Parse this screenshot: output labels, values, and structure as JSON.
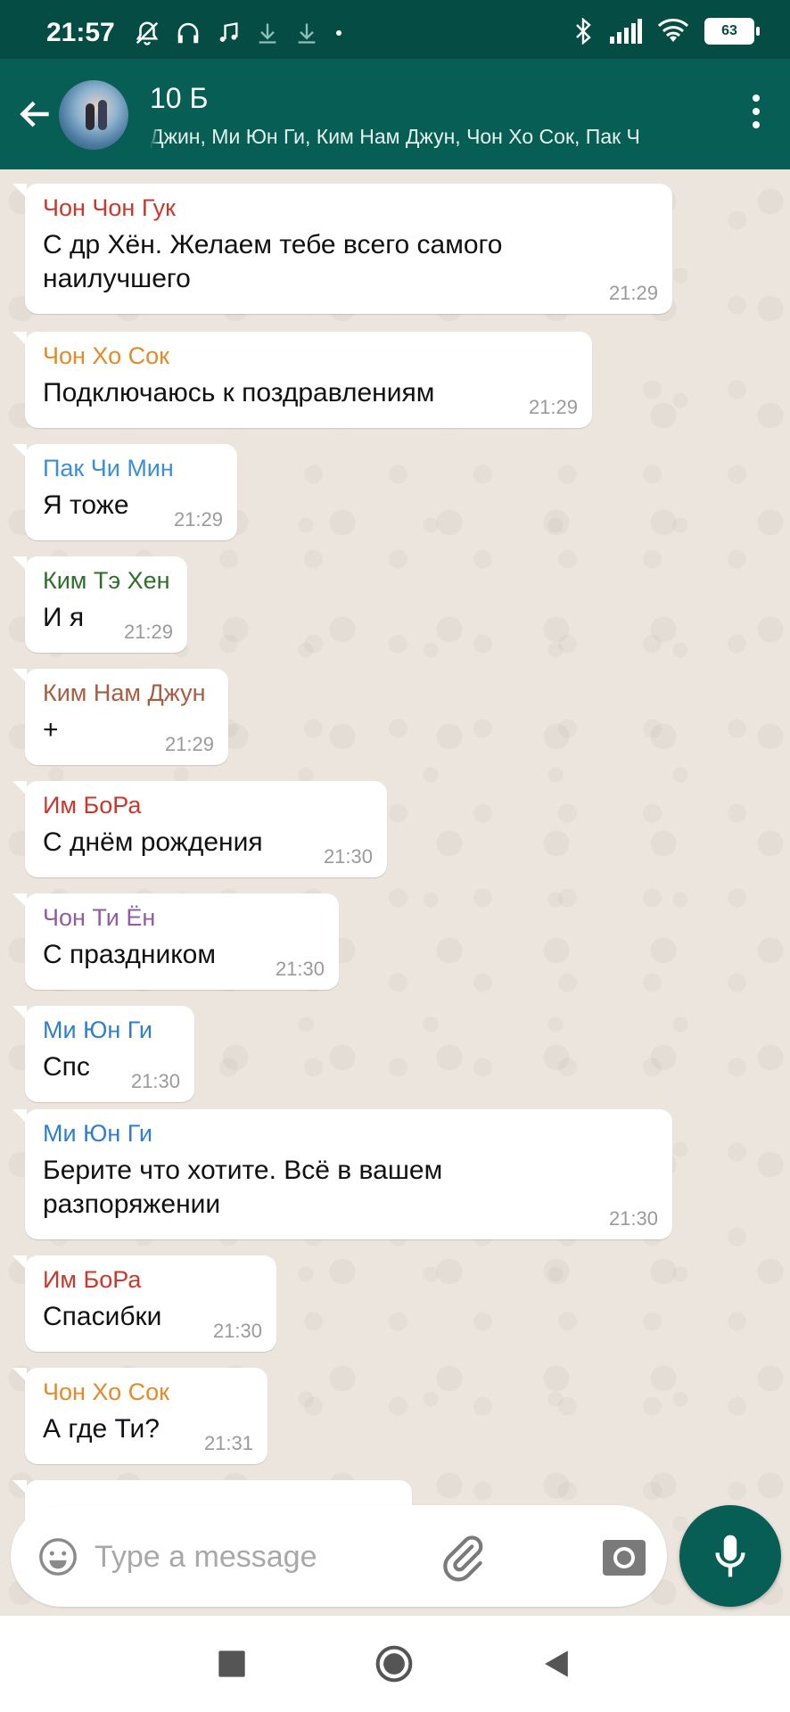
{
  "status_bar": {
    "time": "21:57",
    "battery": "63"
  },
  "header": {
    "title": "10 Б",
    "members": "Джин, Ми Юн Ги, Ким Нам Джун, Чон Хо Сок, Пак Ч"
  },
  "messages": [
    {
      "sender": "Чон Чон Гук",
      "color": "#c8382c",
      "lines": [
        "С др Хён. Желаем тебе всего самого",
        "наилучшего"
      ],
      "time": "21:29"
    },
    {
      "sender": "Чон Хо Сок",
      "color": "#e38a2a",
      "lines": [
        "Подключаюсь к поздравлениям"
      ],
      "time": "21:29"
    },
    {
      "sender": "Пак Чи Мин",
      "color": "#3b8fd6",
      "lines": [
        "Я тоже"
      ],
      "time": "21:29"
    },
    {
      "sender": "Ким Тэ Хен",
      "color": "#2e6e2a",
      "lines": [
        "И я"
      ],
      "time": "21:29"
    },
    {
      "sender": "Ким Нам Джун",
      "color": "#a65e43",
      "lines": [
        "+"
      ],
      "time": "21:29"
    },
    {
      "sender": "Им БоРа",
      "color": "#c8382c",
      "lines": [
        "С днём рождения"
      ],
      "time": "21:30"
    },
    {
      "sender": "Чон Ти Ён",
      "color": "#8e5ea0",
      "lines": [
        "С праздником"
      ],
      "time": "21:30"
    },
    {
      "sender": "Ми Юн Ги",
      "color": "#2f7ecb",
      "lines": [
        "Спс"
      ],
      "time": "21:30"
    },
    {
      "sender": "Ми Юн Ги",
      "color": "#2f7ecb",
      "lines": [
        "Берите что хотите. Всё в вашем",
        "разпоряжении"
      ],
      "time": "21:30"
    },
    {
      "sender": "Им БоРа",
      "color": "#c8382c",
      "lines": [
        "Спасибки"
      ],
      "time": "21:30"
    },
    {
      "sender": "Чон Хо Сок",
      "color": "#e38a2a",
      "lines": [
        "А где Ти?"
      ],
      "time": "21:31"
    }
  ],
  "composer": {
    "placeholder": "Type a message"
  },
  "colors": {
    "header": "#075e54",
    "status_bar": "#054d44",
    "chat_bg": "#ece5dd"
  }
}
